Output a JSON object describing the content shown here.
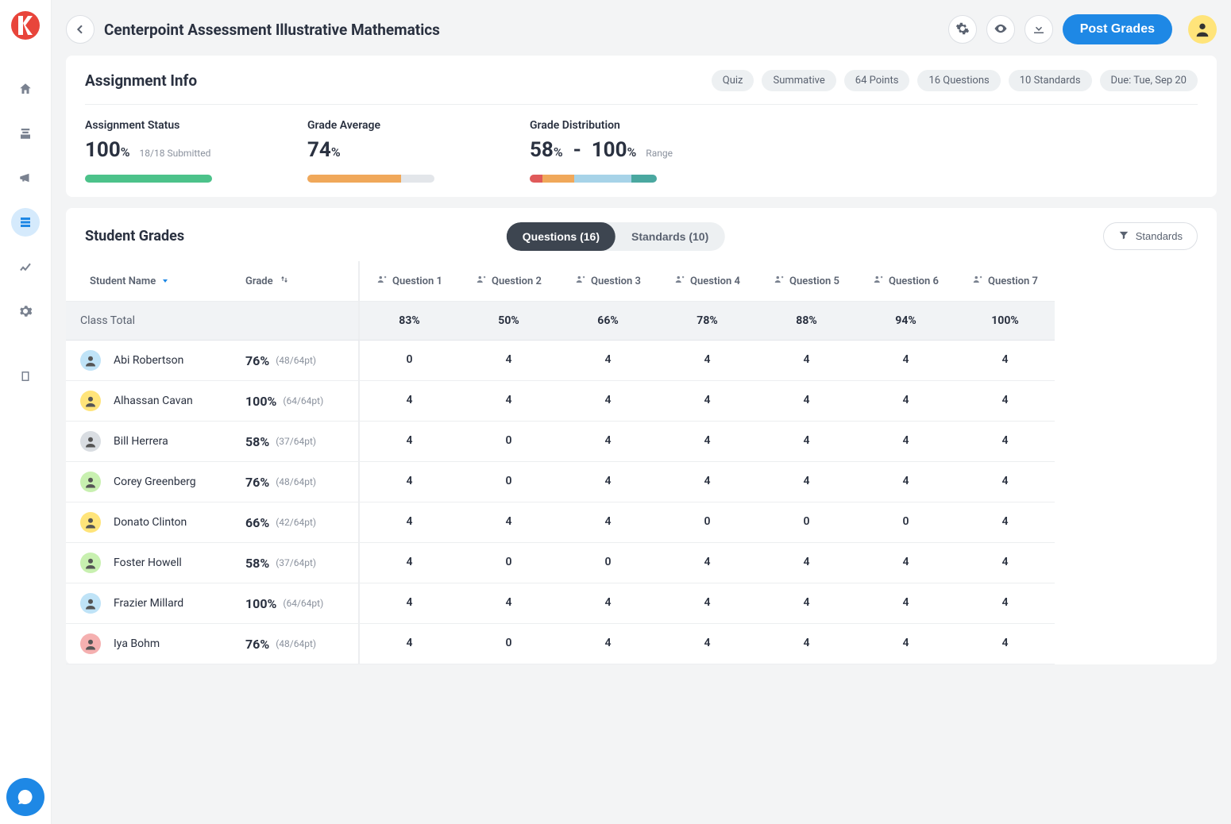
{
  "header": {
    "title": "Centerpoint Assessment Illustrative Mathematics",
    "post_button": "Post Grades"
  },
  "info": {
    "title": "Assignment Info",
    "pills": [
      "Quiz",
      "Summative",
      "64 Points",
      "16 Questions",
      "10 Standards",
      "Due: Tue, Sep 20"
    ],
    "status": {
      "label": "Assignment Status",
      "value": "100",
      "suffix": "%",
      "sub": "18/18 Submitted"
    },
    "average": {
      "label": "Grade Average",
      "value": "74",
      "suffix": "%"
    },
    "distribution": {
      "label": "Grade Distribution",
      "min": "58",
      "max": "100",
      "suffix": "%",
      "sub": "Range"
    }
  },
  "grades": {
    "title": "Student Grades",
    "tab_questions": "Questions (16)",
    "tab_standards": "Standards (10)",
    "filter_label": "Standards",
    "col_student": "Student Name",
    "col_grade": "Grade",
    "question_cols": [
      "Question 1",
      "Question 2",
      "Question 3",
      "Question 4",
      "Question 5",
      "Question 6",
      "Question 7"
    ],
    "class_total_label": "Class Total",
    "class_totals": [
      "83%",
      "50%",
      "66%",
      "78%",
      "88%",
      "94%",
      "100%"
    ],
    "students": [
      {
        "name": "Abi Robertson",
        "grade": "76%",
        "pts": "(48/64pt)",
        "scores": [
          "0",
          "4",
          "4",
          "4",
          "4",
          "4",
          "4"
        ],
        "bg": "#bfe3f7"
      },
      {
        "name": "Alhassan Cavan",
        "grade": "100%",
        "pts": "(64/64pt)",
        "scores": [
          "4",
          "4",
          "4",
          "4",
          "4",
          "4",
          "4"
        ],
        "bg": "#ffe47a"
      },
      {
        "name": "Bill Herrera",
        "grade": "58%",
        "pts": "(37/64pt)",
        "scores": [
          "4",
          "0",
          "4",
          "4",
          "4",
          "4",
          "4"
        ],
        "bg": "#d9dde2"
      },
      {
        "name": "Corey Greenberg",
        "grade": "76%",
        "pts": "(48/64pt)",
        "scores": [
          "4",
          "0",
          "4",
          "4",
          "4",
          "4",
          "4"
        ],
        "bg": "#c8f0b0"
      },
      {
        "name": "Donato Clinton",
        "grade": "66%",
        "pts": "(42/64pt)",
        "scores": [
          "4",
          "4",
          "4",
          "0",
          "0",
          "0",
          "4"
        ],
        "bg": "#ffe47a"
      },
      {
        "name": "Foster Howell",
        "grade": "58%",
        "pts": "(37/64pt)",
        "scores": [
          "4",
          "0",
          "0",
          "4",
          "4",
          "4",
          "4"
        ],
        "bg": "#c8f0b0"
      },
      {
        "name": "Frazier Millard",
        "grade": "100%",
        "pts": "(64/64pt)",
        "scores": [
          "4",
          "4",
          "4",
          "4",
          "4",
          "4",
          "4"
        ],
        "bg": "#bfe3f7"
      },
      {
        "name": "Iya Bohm",
        "grade": "76%",
        "pts": "(48/64pt)",
        "scores": [
          "4",
          "0",
          "4",
          "4",
          "4",
          "4",
          "4"
        ],
        "bg": "#f5b0b0"
      }
    ]
  }
}
